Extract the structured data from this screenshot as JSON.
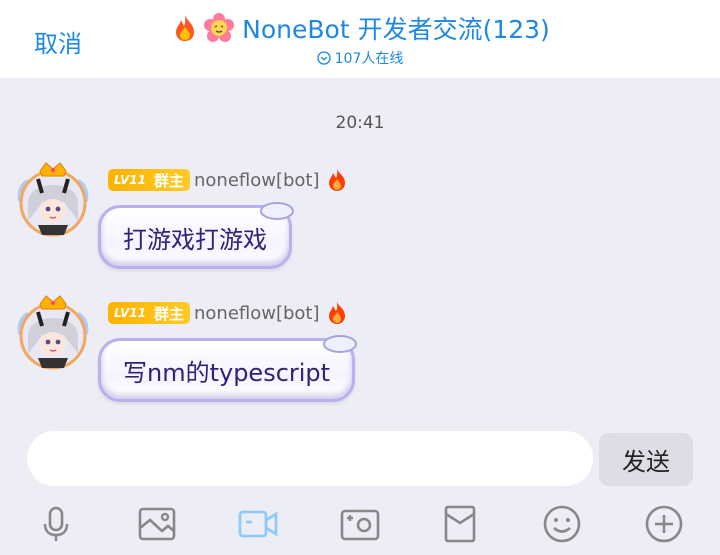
{
  "header": {
    "cancel_label": "取消",
    "title": "NoneBot 开发者交流(123)",
    "online_text": "107人在线",
    "accent_color": "#1e88e5"
  },
  "chat": {
    "timestamp": "20:41",
    "messages": [
      {
        "level_badge": "LV11",
        "role_badge": "群主",
        "sender": "noneflow[bot]",
        "text": "打游戏打游戏"
      },
      {
        "level_badge": "LV11",
        "role_badge": "群主",
        "sender": "noneflow[bot]",
        "text": "写nm的typescript"
      }
    ]
  },
  "composer": {
    "input_value": "",
    "send_label": "发送"
  },
  "toolbar": {
    "items": [
      "microphone-icon",
      "image-icon",
      "video-camera-icon",
      "camera-icon",
      "red-packet-icon",
      "emoji-icon",
      "plus-icon"
    ],
    "active_item": "video-camera-icon",
    "active_color": "#90caf9",
    "icon_color": "#888888"
  }
}
